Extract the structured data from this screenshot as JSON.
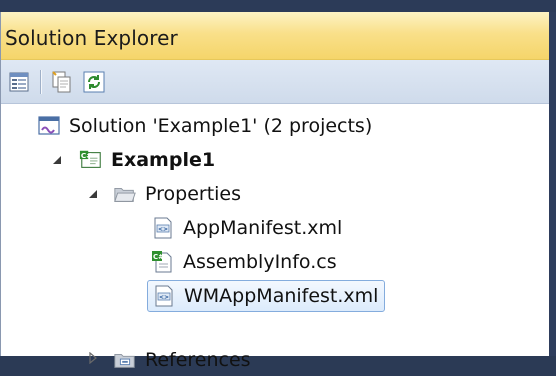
{
  "panel": {
    "title": "Solution Explorer"
  },
  "toolbar": {
    "buttons": [
      {
        "name": "properties-icon"
      },
      {
        "name": "show-all-files-icon"
      },
      {
        "name": "refresh-icon"
      }
    ]
  },
  "tree": {
    "solution": {
      "label": "Solution 'Example1' (2 projects)",
      "icon": "solution-icon"
    },
    "project": {
      "label": "Example1",
      "icon": "csharp-project-icon",
      "expanded": true
    },
    "properties_folder": {
      "label": "Properties",
      "icon": "folder-open-icon",
      "expanded": true
    },
    "files": [
      {
        "label": "AppManifest.xml",
        "icon": "xml-file-icon",
        "selected": false
      },
      {
        "label": "AssemblyInfo.cs",
        "icon": "csharp-file-icon",
        "selected": false
      },
      {
        "label": "WMAppManifest.xml",
        "icon": "xml-file-icon",
        "selected": true
      }
    ],
    "references": {
      "label": "References",
      "icon": "references-icon",
      "expanded": false
    }
  },
  "colors": {
    "title_bg": "#f9e08a",
    "toolbar_bg": "#d6e0ee",
    "selection_border": "#84acdd",
    "chrome": "#2e3d5c"
  }
}
